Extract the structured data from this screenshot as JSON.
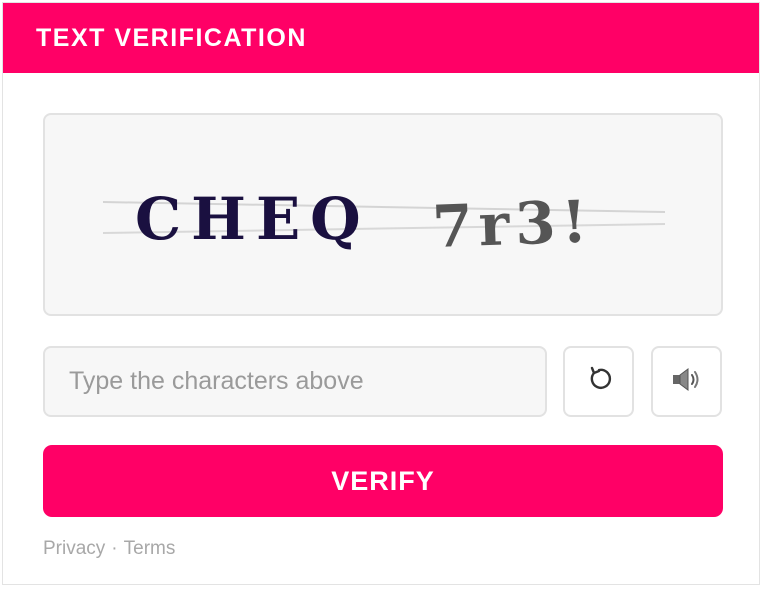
{
  "header": {
    "title": "TEXT VERIFICATION"
  },
  "captcha": {
    "part1": "CHEQ",
    "part2": "7r3!",
    "part1_color": "#1a1040",
    "part2_color": "#555555"
  },
  "input": {
    "placeholder": "Type the characters above",
    "value": ""
  },
  "icons": {
    "refresh": "refresh-icon",
    "audio": "speaker-icon"
  },
  "verify": {
    "label": "VERIFY"
  },
  "footer": {
    "privacy": "Privacy",
    "separator": "·",
    "terms": "Terms"
  },
  "colors": {
    "accent": "#ff0066",
    "header_text": "#ffffff"
  }
}
